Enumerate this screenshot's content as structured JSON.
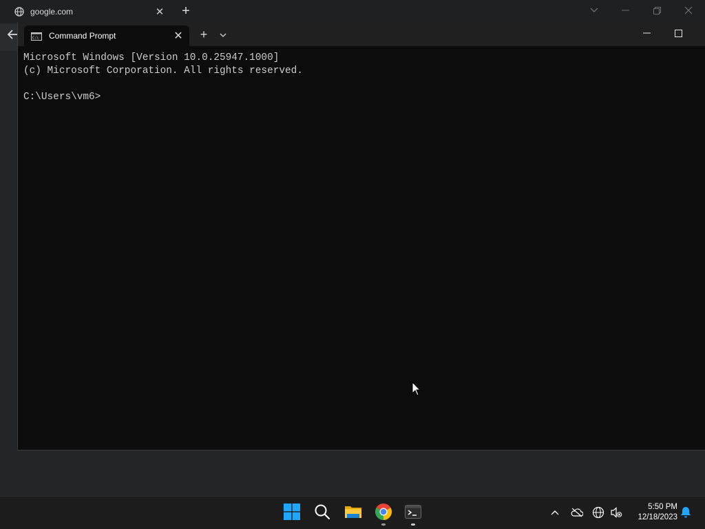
{
  "browser": {
    "tab_title": "google.com",
    "tab_close": "✕",
    "new_tab": "+",
    "back": "←"
  },
  "terminal": {
    "tab_title": "Command Prompt",
    "tab_close": "✕",
    "new_tab": "+",
    "output_lines": [
      "Microsoft Windows [Version 10.0.25947.1000]",
      "(c) Microsoft Corporation. All rights reserved.",
      "",
      "C:\\Users\\vm6>"
    ]
  },
  "taskbar": {
    "time": "5:50 PM",
    "date": "12/18/2023",
    "apps": [
      "start-icon",
      "search-icon",
      "file-explorer-icon",
      "chrome-icon",
      "terminal-icon"
    ]
  },
  "colors": {
    "terminal_bg": "#0c0c0c",
    "terminal_text": "#cccccc",
    "windows_blue": "#1ea7fd"
  }
}
